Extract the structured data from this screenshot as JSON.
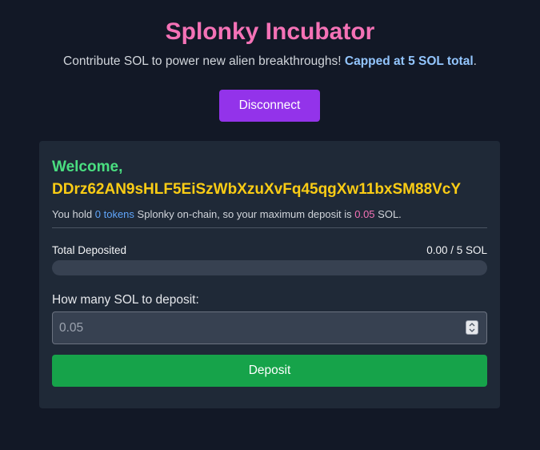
{
  "header": {
    "title": "Splonky Incubator",
    "subtitle_prefix": "Contribute SOL to power new alien breakthroughs!",
    "subtitle_cap": "Capped at 5 SOL total",
    "subtitle_suffix": "."
  },
  "actions": {
    "disconnect_label": "Disconnect"
  },
  "wallet": {
    "welcome_label": "Welcome,",
    "address": "DDrz62AN9sHLF5EiSzWbXzuXvFq45qgXw11bxSM88VcY",
    "holding_prefix": "You hold",
    "token_count": "0 tokens",
    "holding_middle": "Splonky on-chain, so your maximum deposit is",
    "max_deposit": "0.05",
    "holding_suffix": "SOL."
  },
  "progress": {
    "label": "Total Deposited",
    "value_text": "0.00 / 5 SOL",
    "fraction": 0
  },
  "deposit": {
    "label": "How many SOL to deposit:",
    "placeholder": "0.05",
    "button_label": "Deposit"
  },
  "colors": {
    "background": "#121826",
    "card": "#1f2937",
    "title": "#f472b6",
    "cap_highlight": "#93c5fd",
    "welcome": "#4ade80",
    "address": "#facc15",
    "tokens": "#60a5fa",
    "max_deposit": "#f472b6",
    "disconnect_button": "#9333ea",
    "deposit_button": "#16a34a"
  },
  "icons": {
    "spinner": "number-stepper-icon"
  }
}
